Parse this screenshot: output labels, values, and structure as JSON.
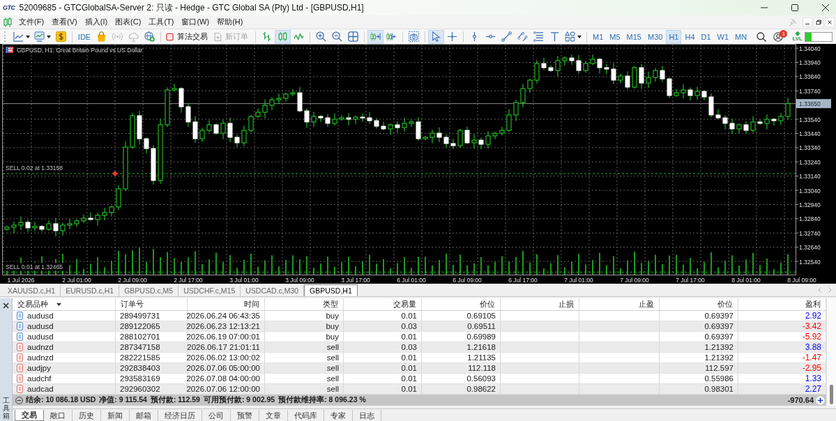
{
  "window": {
    "logo": "GTC",
    "title": "52009685 - GTCGlobalSA-Server 2: 只读 - Hedge - GTC Global SA (Pty) Ltd - [GBPUSD,H1]"
  },
  "menu": [
    {
      "label": "文件(F)"
    },
    {
      "label": "查看(V)"
    },
    {
      "label": "插入(I)"
    },
    {
      "label": "图表(C)"
    },
    {
      "label": "工具(T)"
    },
    {
      "label": "窗口(W)"
    },
    {
      "label": "帮助(H)"
    }
  ],
  "toolbar": {
    "ide": "IDE",
    "services": [
      {
        "disabled": false
      },
      {
        "disabled": true
      },
      {
        "disabled": true
      },
      {
        "disabled": false
      }
    ],
    "algo_trading": {
      "label": "算法交易",
      "on": false
    },
    "new_order": {
      "label": "新订单",
      "disabled": true
    },
    "chart_types": [
      {
        "selected": false
      },
      {
        "selected": true
      },
      {
        "selected": false
      }
    ],
    "chart_options": [
      {
        "selected": true
      },
      {
        "selected": false
      }
    ],
    "cursor_tools": [
      {
        "selected": true
      },
      {
        "selected": false
      }
    ],
    "timeframes": [
      {
        "label": "M1",
        "selected": false
      },
      {
        "label": "M5",
        "selected": false
      },
      {
        "label": "M15",
        "selected": false
      },
      {
        "label": "M30",
        "selected": false
      },
      {
        "label": "H1",
        "selected": true
      },
      {
        "label": "H4",
        "selected": false
      },
      {
        "label": "D1",
        "selected": false
      },
      {
        "label": "W1",
        "selected": false
      },
      {
        "label": "MN",
        "selected": false
      }
    ],
    "notifications": {
      "badge": "1"
    },
    "level_label": "LVL",
    "meter": {
      "level": 0.24
    }
  },
  "chart": {
    "chart_data": {
      "type": "candlestick",
      "title": "GBPUSD, H1: Great Britain Pound vs US Dollar",
      "categories": [
        null,
        null,
        "1 Jul 2026",
        null,
        null,
        null,
        null,
        null,
        null,
        null,
        "2 Jul 01:00",
        null,
        null,
        null,
        null,
        null,
        null,
        null,
        "2 Jul 09:00",
        null,
        null,
        null,
        null,
        null,
        null,
        null,
        "2 Jul 17:00",
        null,
        null,
        null,
        null,
        null,
        null,
        null,
        "3 Jul 01:00",
        null,
        null,
        null,
        null,
        null,
        null,
        null,
        "3 Jul 09:00",
        null,
        null,
        null,
        null,
        null,
        null,
        null,
        "3 Jul 17:00",
        null,
        null,
        null,
        null,
        null,
        null,
        null,
        "6 Jul 01:00",
        null,
        null,
        null,
        null,
        null,
        null,
        null,
        "6 Jul 09:00",
        null,
        null,
        null,
        null,
        null,
        null,
        null,
        "6 Jul 17:00",
        null,
        null,
        null,
        null,
        null,
        null,
        null,
        "7 Jul 01:00",
        null,
        null,
        null,
        null,
        null,
        null,
        null,
        "7 Jul 09:00",
        null,
        null,
        null,
        null,
        null,
        null,
        null,
        "7 Jul 17:00",
        null,
        null,
        null,
        null,
        null,
        null,
        null,
        "8 Jul 01:00",
        null,
        null,
        null,
        null,
        null,
        null,
        null,
        "8 Jul 09:00"
      ],
      "ohlc": [
        [
          1.32766,
          1.32791,
          1.32756,
          1.32781
        ],
        [
          1.32781,
          1.3282,
          1.32739,
          1.32795
        ],
        [
          1.32795,
          1.32856,
          1.3276,
          1.32815
        ],
        [
          1.32815,
          1.32833,
          1.32747,
          1.32776
        ],
        [
          1.32776,
          1.32819,
          1.32753,
          1.32786
        ],
        [
          1.32786,
          1.32796,
          1.3275,
          1.32766
        ],
        [
          1.32766,
          1.3283,
          1.32756,
          1.32805
        ],
        [
          1.32805,
          1.32846,
          1.32714,
          1.32756
        ],
        [
          1.32756,
          1.32813,
          1.32721,
          1.32795
        ],
        [
          1.32795,
          1.32838,
          1.32766,
          1.32805
        ],
        [
          1.32805,
          1.32835,
          1.32782,
          1.32825
        ],
        [
          1.32825,
          1.32869,
          1.32809,
          1.32844
        ],
        [
          1.32844,
          1.32885,
          1.32825,
          1.32835
        ],
        [
          1.32835,
          1.32882,
          1.32793,
          1.32864
        ],
        [
          1.32864,
          1.32917,
          1.32829,
          1.32884
        ],
        [
          1.32884,
          1.32933,
          1.32855,
          1.32923
        ],
        [
          1.32923,
          1.33075,
          1.329,
          1.3305
        ],
        [
          1.3305,
          1.33385,
          1.33034,
          1.33344
        ],
        [
          1.33344,
          1.33583,
          1.33334,
          1.33565
        ],
        [
          1.33565,
          1.33598,
          1.33361,
          1.33403
        ],
        [
          1.33403,
          1.33413,
          1.33299,
          1.33334
        ],
        [
          1.33334,
          1.33359,
          1.3308,
          1.33109
        ],
        [
          1.33109,
          1.33542,
          1.33086,
          1.33501
        ],
        [
          1.33501,
          1.33764,
          1.33485,
          1.33746
        ],
        [
          1.33746,
          1.33789,
          1.33736,
          1.33756
        ],
        [
          1.33756,
          1.33766,
          1.33586,
          1.33628
        ],
        [
          1.33628,
          1.33653,
          1.33486,
          1.33521
        ],
        [
          1.33521,
          1.33562,
          1.33374,
          1.33403
        ],
        [
          1.33403,
          1.3348,
          1.3338,
          1.33462
        ],
        [
          1.33462,
          1.33534,
          1.33446,
          1.33501
        ],
        [
          1.33501,
          1.33511,
          1.33432,
          1.33442
        ],
        [
          1.33442,
          1.33536,
          1.334,
          1.33511
        ],
        [
          1.33511,
          1.33552,
          1.33378,
          1.33413
        ],
        [
          1.33413,
          1.33431,
          1.33345,
          1.33374
        ],
        [
          1.33374,
          1.33495,
          1.33351,
          1.33462
        ],
        [
          1.33462,
          1.3357,
          1.33446,
          1.3356
        ],
        [
          1.3356,
          1.33614,
          1.3355,
          1.33589
        ],
        [
          1.33589,
          1.33679,
          1.33547,
          1.33638
        ],
        [
          1.33638,
          1.33695,
          1.33603,
          1.33677
        ],
        [
          1.33677,
          1.3372,
          1.33648,
          1.33687
        ],
        [
          1.33687,
          1.33727,
          1.33664,
          1.33717
        ],
        [
          1.33717,
          1.33751,
          1.33701,
          1.33726
        ],
        [
          1.33726,
          1.33767,
          1.33589,
          1.33599
        ],
        [
          1.33599,
          1.33617,
          1.33479,
          1.33521
        ],
        [
          1.33521,
          1.33593,
          1.33486,
          1.3356
        ],
        [
          1.3356,
          1.3357,
          1.33521,
          1.3355
        ],
        [
          1.3355,
          1.33575,
          1.33488,
          1.33511
        ],
        [
          1.33511,
          1.33581,
          1.33495,
          1.3354
        ],
        [
          1.3354,
          1.33568,
          1.3353,
          1.3355
        ],
        [
          1.3355,
          1.33583,
          1.33498,
          1.3354
        ],
        [
          1.3354,
          1.33565,
          1.33505,
          1.33555
        ],
        [
          1.33555,
          1.3358,
          1.33521,
          1.3355
        ],
        [
          1.3355,
          1.33591,
          1.33507,
          1.3353
        ],
        [
          1.3353,
          1.33548,
          1.33475,
          1.33491
        ],
        [
          1.33491,
          1.33524,
          1.33462,
          1.33472
        ],
        [
          1.33472,
          1.33511,
          1.3343,
          1.33501
        ],
        [
          1.33501,
          1.33526,
          1.33446,
          1.33481
        ],
        [
          1.33481,
          1.33552,
          1.33452,
          1.33511
        ],
        [
          1.33511,
          1.33539,
          1.33488,
          1.33521
        ],
        [
          1.33521,
          1.33554,
          1.33387,
          1.33403
        ],
        [
          1.33403,
          1.33423,
          1.33393,
          1.33413
        ],
        [
          1.33413,
          1.33467,
          1.33371,
          1.33442
        ],
        [
          1.33442,
          1.33483,
          1.33378,
          1.33413
        ],
        [
          1.33413,
          1.33431,
          1.3334,
          1.33369
        ],
        [
          1.33369,
          1.33402,
          1.33331,
          1.33354
        ],
        [
          1.33354,
          1.33472,
          1.33338,
          1.33462
        ],
        [
          1.33462,
          1.33487,
          1.33364,
          1.33374
        ],
        [
          1.33374,
          1.33434,
          1.33332,
          1.33393
        ],
        [
          1.33393,
          1.33411,
          1.33329,
          1.33364
        ],
        [
          1.33364,
          1.33456,
          1.33335,
          1.33423
        ],
        [
          1.33423,
          1.33452,
          1.334,
          1.33442
        ],
        [
          1.33442,
          1.33487,
          1.33426,
          1.33462
        ],
        [
          1.33462,
          1.33611,
          1.33452,
          1.3357
        ],
        [
          1.3357,
          1.33676,
          1.33528,
          1.33658
        ],
        [
          1.33658,
          1.33789,
          1.33623,
          1.33756
        ],
        [
          1.33756,
          1.33825,
          1.33727,
          1.33815
        ],
        [
          1.33815,
          1.33957,
          1.33792,
          1.33932
        ],
        [
          1.33932,
          1.33973,
          1.33887,
          1.33903
        ],
        [
          1.33903,
          1.33921,
          1.33873,
          1.33883
        ],
        [
          1.33883,
          1.33985,
          1.33841,
          1.33952
        ],
        [
          1.33952,
          1.33981,
          1.33917,
          1.33971
        ],
        [
          1.33971,
          1.33996,
          1.33923,
          1.33952
        ],
        [
          1.33952,
          1.33993,
          1.3386,
          1.33883
        ],
        [
          1.33883,
          1.3395,
          1.33867,
          1.33932
        ],
        [
          1.33932,
          1.33995,
          1.33922,
          1.33962
        ],
        [
          1.33962,
          1.33972,
          1.33861,
          1.33903
        ],
        [
          1.33903,
          1.33928,
          1.33858,
          1.33893
        ],
        [
          1.33893,
          1.33934,
          1.33786,
          1.33815
        ],
        [
          1.33815,
          1.33862,
          1.33792,
          1.33844
        ],
        [
          1.33844,
          1.33877,
          1.3375,
          1.33766
        ],
        [
          1.33766,
          1.33913,
          1.33756,
          1.33903
        ],
        [
          1.33903,
          1.33928,
          1.33753,
          1.33795
        ],
        [
          1.33795,
          1.33875,
          1.3376,
          1.33834
        ],
        [
          1.33834,
          1.33901,
          1.33805,
          1.33883
        ],
        [
          1.33883,
          1.33916,
          1.33801,
          1.33824
        ],
        [
          1.33824,
          1.33834,
          1.33691,
          1.33707
        ],
        [
          1.33707,
          1.33751,
          1.33697,
          1.33726
        ],
        [
          1.33726,
          1.33787,
          1.33684,
          1.33746
        ],
        [
          1.33746,
          1.33764,
          1.33672,
          1.33707
        ],
        [
          1.33707,
          1.33769,
          1.33678,
          1.33736
        ],
        [
          1.33736,
          1.33746,
          1.33674,
          1.33697
        ],
        [
          1.33697,
          1.33722,
          1.33554,
          1.3357
        ],
        [
          1.3357,
          1.33611,
          1.3354,
          1.3355
        ],
        [
          1.3355,
          1.33568,
          1.33469,
          1.33511
        ],
        [
          1.33511,
          1.33544,
          1.33437,
          1.33472
        ],
        [
          1.33472,
          1.33511,
          1.33443,
          1.33501
        ],
        [
          1.33501,
          1.33526,
          1.33439,
          1.33462
        ],
        [
          1.33462,
          1.33562,
          1.33446,
          1.33521
        ],
        [
          1.33521,
          1.33539,
          1.33501,
          1.33511
        ],
        [
          1.33511,
          1.33573,
          1.33469,
          1.3354
        ],
        [
          1.3354,
          1.3355,
          1.33495,
          1.3353
        ],
        [
          1.3353,
          1.33585,
          1.33501,
          1.3356
        ],
        [
          1.3356,
          1.33691,
          1.33537,
          1.3365
        ],
        null,
        null
      ],
      "ylim": [
        1.32447,
        1.34065
      ],
      "yticks": [
        {
          "value": 1.3404,
          "label": "1.34040"
        },
        {
          "value": 1.3394,
          "label": "1.33940"
        },
        {
          "value": 1.3384,
          "label": "1.33840"
        },
        {
          "value": 1.3374,
          "label": "1.33740"
        },
        {
          "value": 1.3354,
          "label": "1.33540"
        },
        {
          "value": 1.3344,
          "label": "1.33440"
        },
        {
          "value": 1.3334,
          "label": "1.33340"
        },
        {
          "value": 1.3324,
          "label": "1.33240"
        },
        {
          "value": 1.3314,
          "label": "1.33140"
        },
        {
          "value": 1.3304,
          "label": "1.33040"
        },
        {
          "value": 1.3294,
          "label": "1.32940"
        },
        {
          "value": 1.3284,
          "label": "1.32840"
        },
        {
          "value": 1.3274,
          "label": "1.32740"
        },
        {
          "value": 1.3264,
          "label": "1.32640"
        },
        {
          "value": 1.3254,
          "label": "1.32540"
        }
      ],
      "grid": true,
      "ref_lines": [
        {
          "axis": "y",
          "value": 1.33158,
          "label": "SELL 0.02 at 1.33158",
          "color": "#1fb81f"
        },
        {
          "axis": "y",
          "value": 1.32465,
          "label": "SELL 0.01 at 1.32465",
          "color": "#1fb81f"
        },
        {
          "axis": "y",
          "value": 1.3365,
          "label": "1.33650",
          "color": "#8c8c8c"
        }
      ]
    }
  },
  "chart_tabs": [
    {
      "label": "XAUUSD.c,H1",
      "selected": false
    },
    {
      "label": "EURUSD.c,H1",
      "selected": false
    },
    {
      "label": "GBPUSD.c,M5",
      "selected": false
    },
    {
      "label": "USDCHF.c,M15",
      "selected": false
    },
    {
      "label": "USDCAD.c,M30",
      "selected": false
    },
    {
      "label": "GBPUSD,H1",
      "selected": true
    }
  ],
  "terminal": {
    "title": "工具箱",
    "columns": [
      {
        "label": "交易品种",
        "sorted": true
      },
      {
        "label": "订单号",
        "sorted": false
      },
      {
        "label": "时间",
        "sorted": false
      },
      {
        "label": "类型",
        "sorted": false
      },
      {
        "label": "交易量",
        "sorted": false
      },
      {
        "label": "价位",
        "sorted": false
      },
      {
        "label": "止损",
        "sorted": false
      },
      {
        "label": "止盈",
        "sorted": false
      },
      {
        "label": "价位",
        "sorted": false
      },
      {
        "label": "盈利",
        "sorted": false
      }
    ],
    "rows": [
      {
        "kind": "buy",
        "symbol": "audusd",
        "order": "289499731",
        "time": "2026.06.24 06:43:35",
        "type": "buy",
        "volume": "0.01",
        "price": "0.69105",
        "current_price": "0.69397",
        "profit": "2.92",
        "color": "#0000ff"
      },
      {
        "kind": "buy",
        "symbol": "audusd",
        "order": "289122065",
        "time": "2026.06.23 12:13:21",
        "type": "buy",
        "volume": "0.03",
        "price": "0.69511",
        "current_price": "0.69397",
        "profit": "-3.42",
        "color": "#ff0000"
      },
      {
        "kind": "buy",
        "symbol": "audusd",
        "order": "288102701",
        "time": "2026.06.19 07:00:01",
        "type": "buy",
        "volume": "0.01",
        "price": "0.69989",
        "current_price": "0.69397",
        "profit": "-5.92",
        "color": "#ff0000"
      },
      {
        "kind": "sell",
        "symbol": "audnzd",
        "order": "287347158",
        "time": "2026.06.17 21:01:11",
        "type": "sell",
        "volume": "0.03",
        "price": "1.21618",
        "current_price": "1.21392",
        "profit": "3.88",
        "color": "#0000ff"
      },
      {
        "kind": "sell",
        "symbol": "audnzd",
        "order": "282221585",
        "time": "2026.06.02 13:00:02",
        "type": "sell",
        "volume": "0.01",
        "price": "1.21135",
        "current_price": "1.21392",
        "profit": "-1.47",
        "color": "#ff0000"
      },
      {
        "kind": "sell",
        "symbol": "audjpy",
        "order": "292838403",
        "time": "2026.07.06 05:00:00",
        "type": "sell",
        "volume": "0.01",
        "price": "112.118",
        "current_price": "112.597",
        "profit": "-2.95",
        "color": "#ff0000"
      },
      {
        "kind": "sell",
        "symbol": "audchf",
        "order": "293583169",
        "time": "2026.07.08 04:00:00",
        "type": "sell",
        "volume": "0.01",
        "price": "0.56093",
        "current_price": "0.55986",
        "profit": "1.33",
        "color": "#0000ff"
      },
      {
        "kind": "sell",
        "symbol": "audcad",
        "order": "292960302",
        "time": "2026.07.06 12:00:00",
        "type": "sell",
        "volume": "0.01",
        "price": "0.98622",
        "current_price": "0.98301",
        "profit": "2.27",
        "color": "#0000ff"
      }
    ],
    "summary": {
      "items": [
        "结余: 10 086.18 USD",
        "净值: 9 115.54",
        "预付款: 112.59",
        "可用预付款: 9 002.95",
        "预付款维持率: 8 096.23 %"
      ],
      "total": "-970.64"
    },
    "tabs": [
      {
        "label": "交易",
        "selected": true
      },
      {
        "label": "敞口",
        "selected": false
      },
      {
        "label": "历史",
        "selected": false
      },
      {
        "label": "新闻",
        "selected": false
      },
      {
        "label": "邮箱",
        "selected": false
      },
      {
        "label": "经济日历",
        "selected": false
      },
      {
        "label": "公司",
        "selected": false
      },
      {
        "label": "预警",
        "selected": false
      },
      {
        "label": "文章",
        "selected": false
      },
      {
        "label": "代码库",
        "selected": false
      },
      {
        "label": "专家",
        "selected": false
      },
      {
        "label": "日志",
        "selected": false
      }
    ]
  }
}
